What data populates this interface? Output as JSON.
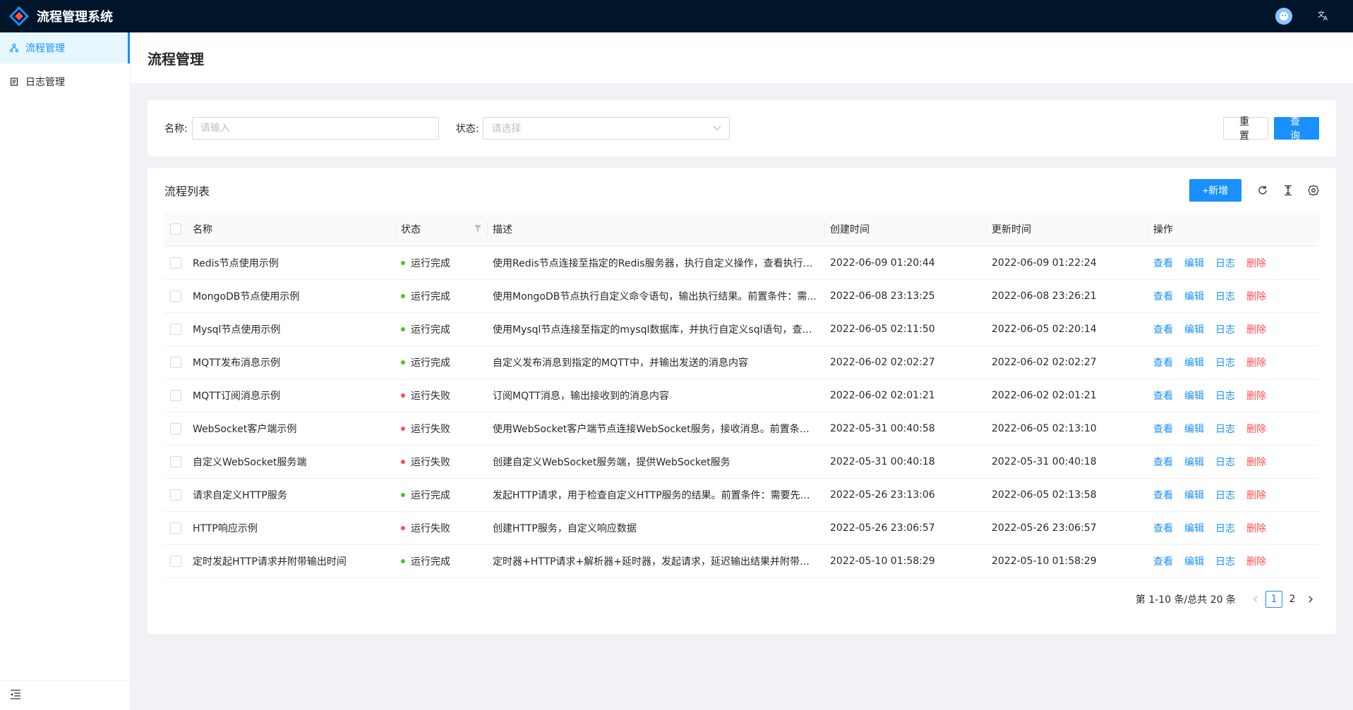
{
  "app": {
    "title": "流程管理系统"
  },
  "sidebar": {
    "items": [
      {
        "label": "流程管理",
        "icon": "cluster-icon",
        "active": true
      },
      {
        "label": "日志管理",
        "icon": "file-icon",
        "active": false
      }
    ]
  },
  "page": {
    "title": "流程管理"
  },
  "search": {
    "name_label": "名称:",
    "name_placeholder": "请输入",
    "status_label": "状态:",
    "status_placeholder": "请选择",
    "reset_label": "重置",
    "query_label": "查询"
  },
  "table": {
    "title": "流程列表",
    "add_label": "+新增",
    "columns": [
      "名称",
      "状态",
      "描述",
      "创建时间",
      "更新时间",
      "操作"
    ],
    "actions": {
      "view": "查看",
      "edit": "编辑",
      "log": "日志",
      "delete": "删除"
    },
    "rows": [
      {
        "name": "Redis节点使用示例",
        "status": "运行完成",
        "ok": true,
        "desc": "使用Redis节点连接至指定的Redis服务器，执行自定义操作，查看执行结...",
        "created": "2022-06-09 01:20:44",
        "updated": "2022-06-09 01:22:24"
      },
      {
        "name": "MongoDB节点使用示例",
        "status": "运行完成",
        "ok": true,
        "desc": "使用MongoDB节点执行自定义命令语句，输出执行结果。前置条件：需...",
        "created": "2022-06-08 23:13:25",
        "updated": "2022-06-08 23:26:21"
      },
      {
        "name": "Mysql节点使用示例",
        "status": "运行完成",
        "ok": true,
        "desc": "使用Mysql节点连接至指定的mysql数据库，并执行自定义sql语句，查看...",
        "created": "2022-06-05 02:11:50",
        "updated": "2022-06-05 02:20:14"
      },
      {
        "name": "MQTT发布消息示例",
        "status": "运行完成",
        "ok": true,
        "desc": "自定义发布消息到指定的MQTT中，并输出发送的消息内容",
        "created": "2022-06-02 02:02:27",
        "updated": "2022-06-02 02:02:27"
      },
      {
        "name": "MQTT订阅消息示例",
        "status": "运行失败",
        "ok": false,
        "desc": "订阅MQTT消息，输出接收到的消息内容",
        "created": "2022-06-02 02:01:21",
        "updated": "2022-06-02 02:01:21"
      },
      {
        "name": "WebSocket客户端示例",
        "status": "运行失败",
        "ok": false,
        "desc": "使用WebSocket客户端节点连接WebSocket服务，接收消息。前置条件：...",
        "created": "2022-05-31 00:40:58",
        "updated": "2022-06-05 02:13:10"
      },
      {
        "name": "自定义WebSocket服务端",
        "status": "运行失败",
        "ok": false,
        "desc": "创建自定义WebSocket服务端，提供WebSocket服务",
        "created": "2022-05-31 00:40:18",
        "updated": "2022-05-31 00:40:18"
      },
      {
        "name": "请求自定义HTTP服务",
        "status": "运行完成",
        "ok": true,
        "desc": "发起HTTP请求，用于检查自定义HTTP服务的结果。前置条件：需要先运...",
        "created": "2022-05-26 23:13:06",
        "updated": "2022-06-05 02:13:58"
      },
      {
        "name": "HTTP响应示例",
        "status": "运行失败",
        "ok": false,
        "desc": "创建HTTP服务，自定义响应数据",
        "created": "2022-05-26 23:06:57",
        "updated": "2022-05-26 23:06:57"
      },
      {
        "name": "定时发起HTTP请求并附带输出时间",
        "status": "运行完成",
        "ok": true,
        "desc": "定时器+HTTP请求+解析器+延时器，发起请求，延迟输出结果并附带请...",
        "created": "2022-05-10 01:58:29",
        "updated": "2022-05-10 01:58:29"
      }
    ]
  },
  "pagination": {
    "total_text": "第 1-10 条/总共 20 条",
    "pages": [
      "1",
      "2"
    ],
    "current": "1"
  },
  "colors": {
    "primary": "#1890ff",
    "success": "#52c41a",
    "error": "#ff4d4f",
    "header_bg": "#001529"
  }
}
